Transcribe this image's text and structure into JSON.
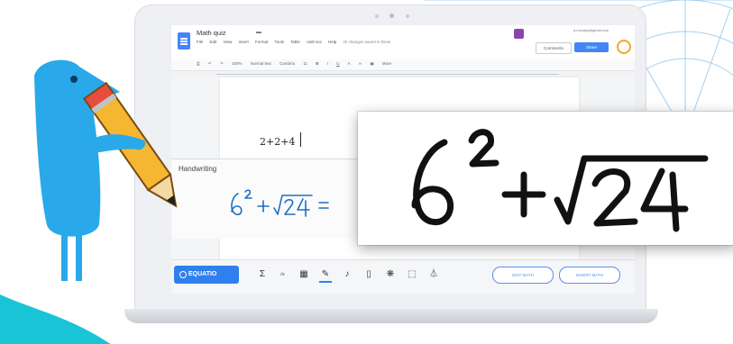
{
  "document": {
    "title": "Math quiz",
    "menu": [
      "File",
      "Edit",
      "View",
      "Insert",
      "Format",
      "Tools",
      "Table",
      "Add-ons",
      "Help"
    ],
    "save_status": "All changes saved in Drive",
    "body_text": "2+2+4",
    "user_email": "a.mcnally@gmail.com",
    "comments_label": "Comments",
    "share_label": "Share"
  },
  "toolbar": {
    "zoom": "100%",
    "style": "Normal text",
    "font": "Cambria",
    "font_size": "11",
    "more": "More"
  },
  "handwriting_panel": {
    "title": "Handwriting",
    "recognized_formula": "6² + √24 ="
  },
  "zoomed_formula": "6² + √24",
  "equatio_bar": {
    "brand": "EQUATIO",
    "insert_math_label": "INSERT MATH",
    "edit_math_label": "EDIT MATH",
    "icons": [
      "math-editor-icon",
      "latex-icon",
      "graph-icon",
      "handwriting-icon",
      "speech-icon",
      "mobile-icon",
      "molecule-icon",
      "screenshot-reader-icon",
      "chemistry-flask-icon"
    ]
  },
  "colors": {
    "docs_blue": "#4285f4",
    "equatio_blue": "#2f80ed",
    "mascot_blue": "#29a9e9",
    "pencil_yellow": "#f5b731",
    "teal_accent": "#19c4d7",
    "handwriting_blue": "#1f6fc0"
  }
}
